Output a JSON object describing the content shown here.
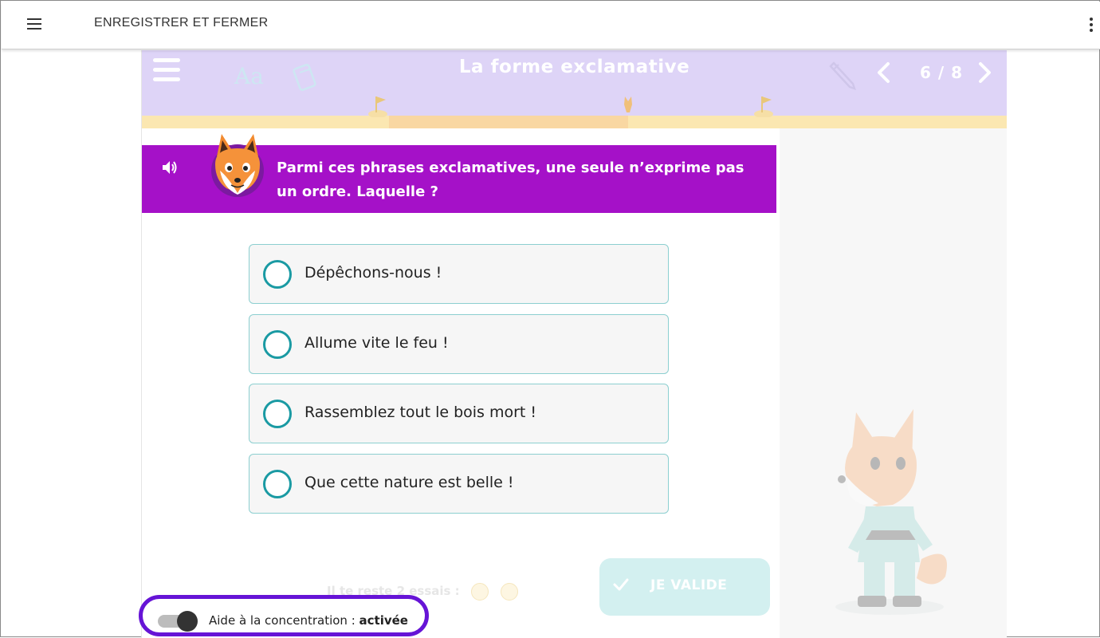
{
  "topbar": {
    "save_label": "ENREGISTRER ET FERMER"
  },
  "activity": {
    "title": "La forme exclamative",
    "pager": "6 / 8",
    "deco_text": "Aa"
  },
  "question": {
    "text": "Parmi ces phrases exclamatives, une seule n’exprime pas un ordre. Laquelle ?"
  },
  "options": [
    {
      "label": "Dépêchons-nous !"
    },
    {
      "label": "Allume vite le feu !"
    },
    {
      "label": "Rassemblez tout le bois mort !"
    },
    {
      "label": "Que cette nature est belle !"
    }
  ],
  "footer": {
    "tries_label": "Il te reste 2 essais :",
    "validate_label": "JE VALIDE"
  },
  "concentration": {
    "label": "Aide à la concentration : ",
    "state": "activée",
    "enabled": true
  },
  "colors": {
    "header_bg": "#ded4f7",
    "question_bg": "#a511c8",
    "accent_teal": "#1a9aa3",
    "highlight": "#6614d6"
  }
}
